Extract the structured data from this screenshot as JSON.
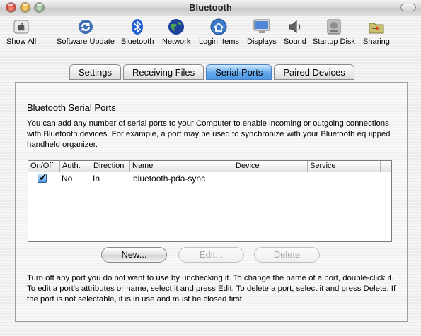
{
  "window": {
    "title": "Bluetooth"
  },
  "toolbar": {
    "items": [
      {
        "label": "Show All",
        "icon": "apple-icon"
      },
      {
        "label": "Software Update",
        "icon": "software-update-icon"
      },
      {
        "label": "Bluetooth",
        "icon": "bluetooth-icon"
      },
      {
        "label": "Network",
        "icon": "globe-icon"
      },
      {
        "label": "Login Items",
        "icon": "house-icon"
      },
      {
        "label": "Displays",
        "icon": "monitor-icon"
      },
      {
        "label": "Sound",
        "icon": "speaker-icon"
      },
      {
        "label": "Startup Disk",
        "icon": "hard-disk-icon"
      },
      {
        "label": "Sharing",
        "icon": "sharing-folder-icon"
      }
    ]
  },
  "tabs": [
    {
      "label": "Settings",
      "active": false
    },
    {
      "label": "Receiving Files",
      "active": false
    },
    {
      "label": "Serial Ports",
      "active": true
    },
    {
      "label": "Paired Devices",
      "active": false
    }
  ],
  "serial_ports": {
    "heading": "Bluetooth Serial Ports",
    "description": "You can add any number of serial ports to your Computer to enable incoming or outgoing connections with Bluetooth devices.  For example, a port may be used to synchronize with your Bluetooth equipped handheld organizer.",
    "columns": [
      "On/Off",
      "Auth.",
      "Direction",
      "Name",
      "Device",
      "Service"
    ],
    "rows": [
      {
        "on": true,
        "auth": "No",
        "direction": "In",
        "name": "bluetooth-pda-sync",
        "device": "",
        "service": ""
      }
    ],
    "buttons": {
      "new": {
        "label": "New...",
        "enabled": true
      },
      "edit": {
        "label": "Edit...",
        "enabled": false
      },
      "delete": {
        "label": "Delete",
        "enabled": false
      }
    },
    "help": "Turn off any port you do not want to use by unchecking it. To change the name of a port, double-click it. To edit a port's attributes or name, select it and press Edit. To delete a port, select it and press Delete. If the port is not selectable, it is in use and must be closed first."
  },
  "colors": {
    "accent": "#4f97e3",
    "disabled_text": "#a8a8a8"
  }
}
